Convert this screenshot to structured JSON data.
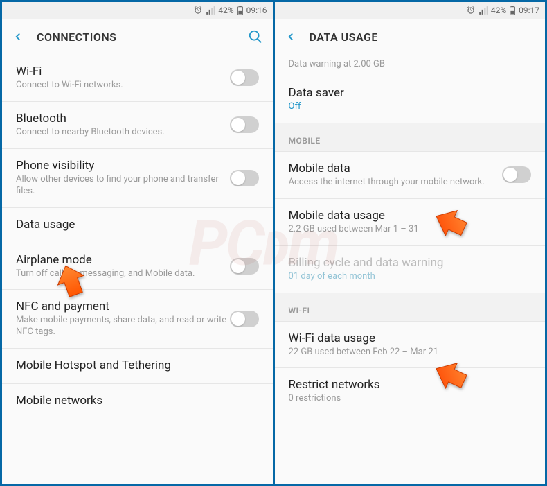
{
  "left": {
    "status": {
      "battery": "42%",
      "time": "09:16"
    },
    "header": "CONNECTIONS",
    "items": [
      {
        "title": "Wi-Fi",
        "sub": "Connect to Wi-Fi networks.",
        "toggle": true
      },
      {
        "title": "Bluetooth",
        "sub": "Connect to nearby Bluetooth devices.",
        "toggle": true
      },
      {
        "title": "Phone visibility",
        "sub": "Allow other devices to find your phone and transfer files.",
        "toggle": true
      },
      {
        "title": "Data usage",
        "sub": "",
        "toggle": false
      },
      {
        "title": "Airplane mode",
        "sub": "Turn off calling, messaging, and Mobile data.",
        "toggle": true
      },
      {
        "title": "NFC and payment",
        "sub": "Make mobile payments, share data, and read or write NFC tags.",
        "toggle": true
      },
      {
        "title": "Mobile Hotspot and Tethering",
        "sub": "",
        "toggle": false
      },
      {
        "title": "Mobile networks",
        "sub": "",
        "toggle": false
      }
    ]
  },
  "right": {
    "status": {
      "battery": "42%",
      "time": "09:17"
    },
    "header": "DATA USAGE",
    "warning": "Data warning at 2.00 GB",
    "datasaver": {
      "title": "Data saver",
      "value": "Off"
    },
    "mobileSection": "MOBILE",
    "mobileData": {
      "title": "Mobile data",
      "sub": "Access the internet through your mobile network."
    },
    "mobileUsage": {
      "title": "Mobile data usage",
      "sub": "2.2 GB used between Mar 1 – 31"
    },
    "billing": {
      "title": "Billing cycle and data warning",
      "sub": "01 day of each month"
    },
    "wifiSection": "WI-FI",
    "wifiUsage": {
      "title": "Wi-Fi data usage",
      "sub": "22 GB used between Feb 22 – Mar 21"
    },
    "restrict": {
      "title": "Restrict networks",
      "sub": "0 restrictions"
    }
  },
  "watermark": "PCrisk.com"
}
